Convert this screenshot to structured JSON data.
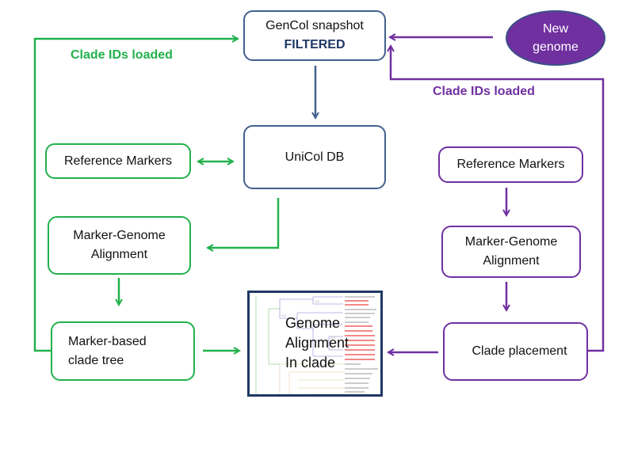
{
  "diagram": {
    "top": {
      "snapshot_title": "GenCol snapshot",
      "snapshot_subtitle": "FILTERED",
      "new_genome_line1": "New",
      "new_genome_line2": "genome"
    },
    "left_flow": {
      "loop_label": "Clade IDs loaded",
      "reference_markers": "Reference Markers",
      "alignment_line1": "Marker-Genome",
      "alignment_line2": "Alignment",
      "tree_line1": "Marker-based",
      "tree_line2": "clade tree"
    },
    "center": {
      "db_label": "UniCol DB",
      "tree_overlay_line1": "Genome",
      "tree_overlay_line2": "Alignment",
      "tree_overlay_line3": "In clade"
    },
    "right_flow": {
      "loop_label": "Clade IDs loaded",
      "reference_markers": "Reference Markers",
      "alignment_line1": "Marker-Genome",
      "alignment_line2": "Alignment",
      "placement": "Clade placement"
    },
    "colors": {
      "left_flow": "#22b14c",
      "right_flow": "#7030a0",
      "center": "#41618e",
      "tree_frame": "#1f3864"
    }
  }
}
